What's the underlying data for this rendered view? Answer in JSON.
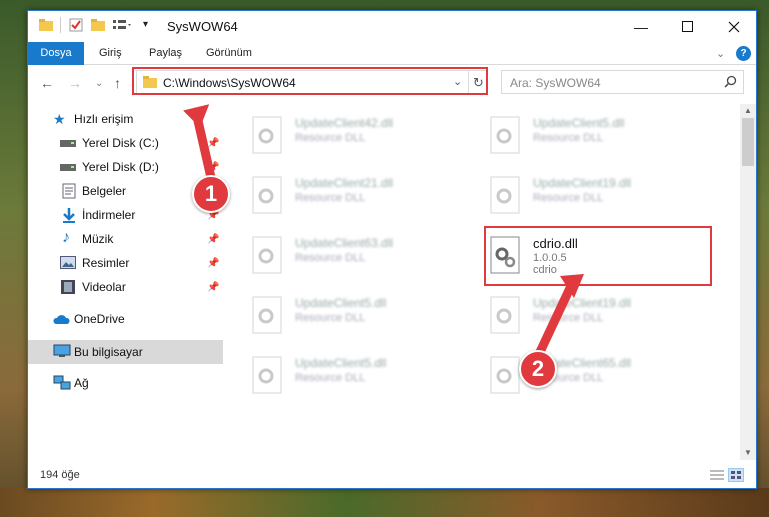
{
  "window": {
    "title": "SysWOW64",
    "controls": {
      "minimize_icon": "minimize-icon",
      "maximize_icon": "maximize-icon",
      "close_icon": "close-icon"
    }
  },
  "ribbon": {
    "tabs": [
      "Dosya",
      "Giriş",
      "Paylaş",
      "Görünüm"
    ],
    "active_tab": "Dosya",
    "accent": "#1979ca"
  },
  "nav": {
    "address": "C:\\Windows\\SysWOW64",
    "search_placeholder": "Ara: SysWOW64"
  },
  "sidebar": {
    "items": [
      {
        "label": "Hızlı erişim",
        "icon": "star-icon"
      },
      {
        "label": "Yerel Disk (C:)",
        "icon": "drive-icon",
        "pinned": true
      },
      {
        "label": "Yerel Disk (D:)",
        "icon": "drive-icon",
        "pinned": true
      },
      {
        "label": "Belgeler",
        "icon": "document-icon",
        "pinned": true
      },
      {
        "label": "İndirmeler",
        "icon": "download-icon",
        "pinned": true
      },
      {
        "label": "Müzik",
        "icon": "music-icon",
        "pinned": true
      },
      {
        "label": "Resimler",
        "icon": "picture-icon",
        "pinned": true
      },
      {
        "label": "Videolar",
        "icon": "video-icon",
        "pinned": true
      },
      {
        "label": "OneDrive",
        "icon": "cloud-icon"
      },
      {
        "label": "Bu bilgisayar",
        "icon": "computer-icon",
        "selected": true
      },
      {
        "label": "Ağ",
        "icon": "network-icon"
      }
    ]
  },
  "files": {
    "left": [
      {
        "name": "UpdateClient42.dll",
        "desc": "Resource DLL"
      },
      {
        "name": "UpdateClient21.dll",
        "desc": "Resource DLL"
      },
      {
        "name": "UpdateClient63.dll",
        "desc": "Resource DLL"
      },
      {
        "name": "UpdateClient5.dll",
        "desc": "Resource DLL"
      },
      {
        "name": "UpdateClient5.dll",
        "desc": "Resource DLL"
      }
    ],
    "right": [
      {
        "name": "UpdateClient5.dll",
        "desc": "Resource DLL"
      },
      {
        "name": "UpdateClient19.dll",
        "desc": "Resource DLL"
      },
      {
        "name": "cdrio.dll",
        "desc": "1.0.0.5",
        "desc2": "cdrio"
      },
      {
        "name": "UpdateClient19.dll",
        "desc": "Resource DLL"
      },
      {
        "name": "UpdateClient65.dll",
        "desc": "Resource DLL"
      }
    ]
  },
  "status": {
    "count": "194 öğe"
  },
  "annotations": {
    "badge1": "1",
    "badge2": "2",
    "color": "#e0393e"
  }
}
